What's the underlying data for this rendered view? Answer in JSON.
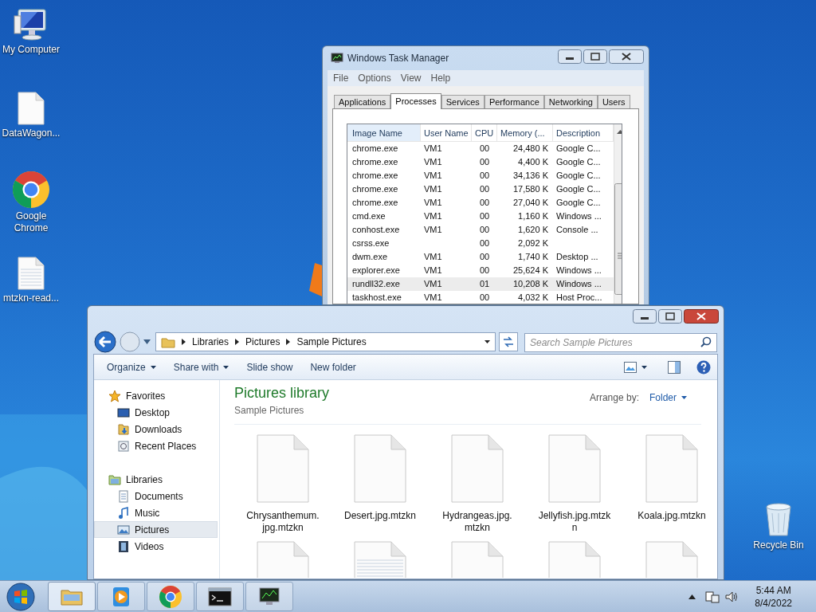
{
  "desktop_icons": [
    {
      "label": "My Computer",
      "kind": "computer"
    },
    {
      "label": "DataWagon...",
      "kind": "document"
    },
    {
      "label": "Google Chrome",
      "kind": "chrome"
    },
    {
      "label": "mtzkn-read...",
      "kind": "text"
    },
    {
      "label": "Recycle Bin",
      "kind": "recycle"
    }
  ],
  "task_manager": {
    "title": "Windows Task Manager",
    "menu": [
      "File",
      "Options",
      "View",
      "Help"
    ],
    "tabs": [
      {
        "label": "Applications",
        "selected": false
      },
      {
        "label": "Processes",
        "selected": true
      },
      {
        "label": "Services",
        "selected": false
      },
      {
        "label": "Performance",
        "selected": false
      },
      {
        "label": "Networking",
        "selected": false
      },
      {
        "label": "Users",
        "selected": false
      }
    ],
    "columns": [
      "Image Name",
      "User Name",
      "CPU",
      "Memory (...",
      "Description"
    ],
    "rows": [
      {
        "cells": [
          "chrome.exe",
          "VM1",
          "00",
          "24,480 K",
          "Google C..."
        ],
        "selected": false
      },
      {
        "cells": [
          "chrome.exe",
          "VM1",
          "00",
          "4,400 K",
          "Google C..."
        ],
        "selected": false
      },
      {
        "cells": [
          "chrome.exe",
          "VM1",
          "00",
          "34,136 K",
          "Google C..."
        ],
        "selected": false
      },
      {
        "cells": [
          "chrome.exe",
          "VM1",
          "00",
          "17,580 K",
          "Google C..."
        ],
        "selected": false
      },
      {
        "cells": [
          "chrome.exe",
          "VM1",
          "00",
          "27,040 K",
          "Google C..."
        ],
        "selected": false
      },
      {
        "cells": [
          "cmd.exe",
          "VM1",
          "00",
          "1,160 K",
          "Windows ..."
        ],
        "selected": false
      },
      {
        "cells": [
          "conhost.exe",
          "VM1",
          "00",
          "1,620 K",
          "Console ..."
        ],
        "selected": false
      },
      {
        "cells": [
          "csrss.exe",
          "",
          "00",
          "2,092 K",
          ""
        ],
        "selected": false
      },
      {
        "cells": [
          "dwm.exe",
          "VM1",
          "00",
          "1,740 K",
          "Desktop ..."
        ],
        "selected": false
      },
      {
        "cells": [
          "explorer.exe",
          "VM1",
          "00",
          "25,624 K",
          "Windows ..."
        ],
        "selected": false
      },
      {
        "cells": [
          "rundll32.exe",
          "VM1",
          "01",
          "10,208 K",
          "Windows ..."
        ],
        "selected": true
      },
      {
        "cells": [
          "taskhost.exe",
          "VM1",
          "00",
          "4,032 K",
          "Host Proc..."
        ],
        "selected": false
      }
    ]
  },
  "explorer": {
    "breadcrumb": [
      "Libraries",
      "Pictures",
      "Sample Pictures"
    ],
    "search": {
      "placeholder": "Search Sample Pictures"
    },
    "toolbar": [
      {
        "label": "Organize",
        "dropdown": true
      },
      {
        "label": "Share with",
        "dropdown": true
      },
      {
        "label": "Slide show",
        "dropdown": false
      },
      {
        "label": "New folder",
        "dropdown": false
      }
    ],
    "sidebar": [
      {
        "label": "Favorites",
        "kind": "star",
        "selected": false,
        "children": [
          {
            "label": "Desktop",
            "kind": "desktop",
            "selected": false
          },
          {
            "label": "Downloads",
            "kind": "downloads",
            "selected": false
          },
          {
            "label": "Recent Places",
            "kind": "recent",
            "selected": false
          }
        ]
      },
      {
        "label": "Libraries",
        "kind": "library",
        "selected": false,
        "children": [
          {
            "label": "Documents",
            "kind": "documents",
            "selected": false
          },
          {
            "label": "Music",
            "kind": "music",
            "selected": false
          },
          {
            "label": "Pictures",
            "kind": "pictures",
            "selected": true
          },
          {
            "label": "Videos",
            "kind": "videos",
            "selected": false
          }
        ]
      }
    ],
    "heading": "Pictures library",
    "subheading": "Sample Pictures",
    "arrange_label": "Arrange by:",
    "arrange_value": "Folder",
    "files": [
      {
        "lines": [
          "Chrysanthemum.",
          "jpg.mtzkn"
        ],
        "kind": "blank"
      },
      {
        "lines": [
          "Desert.jpg.mtzkn"
        ],
        "kind": "blank"
      },
      {
        "lines": [
          "Hydrangeas.jpg.",
          "mtzkn"
        ],
        "kind": "blank"
      },
      {
        "lines": [
          "Jellyfish.jpg.mtzk",
          "n"
        ],
        "kind": "blank"
      },
      {
        "lines": [
          "Koala.jpg.mtzkn"
        ],
        "kind": "blank"
      },
      {
        "kind": "blank"
      },
      {
        "kind": "text"
      },
      {
        "kind": "blank"
      },
      {
        "kind": "blank"
      },
      {
        "kind": "blank"
      }
    ]
  },
  "taskbar": {
    "items": [
      {
        "kind": "explorer",
        "selected": true
      },
      {
        "kind": "media"
      },
      {
        "kind": "chrome"
      },
      {
        "kind": "console"
      },
      {
        "kind": "taskmgr"
      }
    ],
    "time": "5:44 AM",
    "date": "8/4/2022"
  }
}
